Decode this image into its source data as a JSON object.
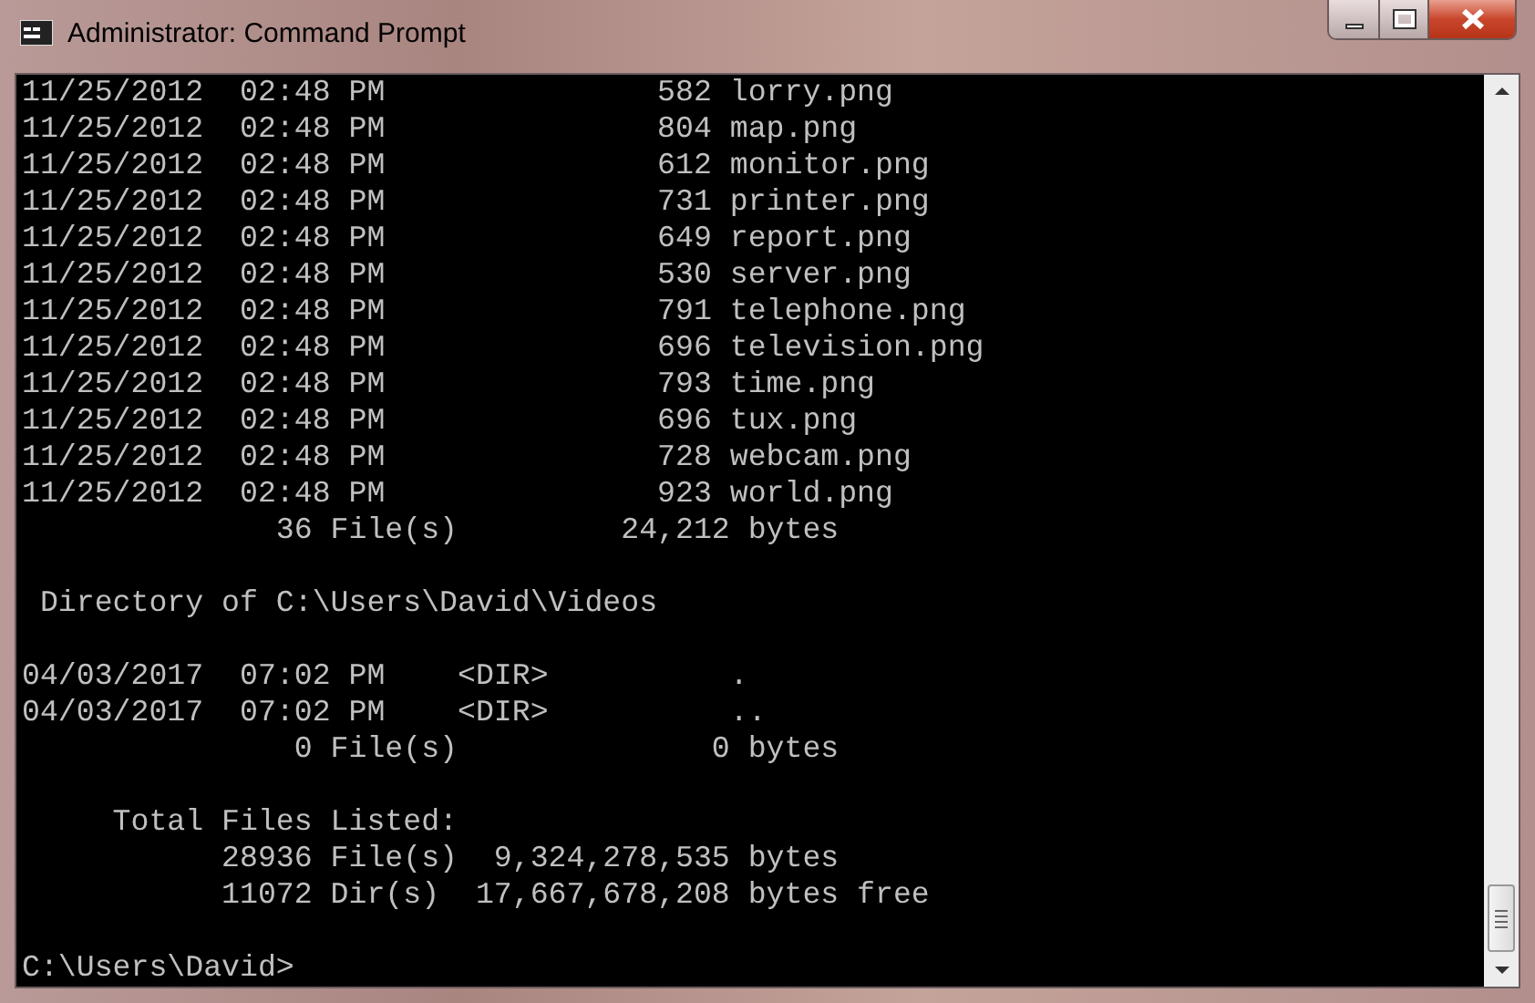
{
  "window": {
    "title": "Administrator: Command Prompt"
  },
  "console": {
    "blocks": [
      [
        "11/25/2012  02:48 PM               582 lorry.png",
        "11/25/2012  02:48 PM               804 map.png",
        "11/25/2012  02:48 PM               612 monitor.png",
        "11/25/2012  02:48 PM               731 printer.png",
        "11/25/2012  02:48 PM               649 report.png",
        "11/25/2012  02:48 PM               530 server.png",
        "11/25/2012  02:48 PM               791 telephone.png",
        "11/25/2012  02:48 PM               696 television.png",
        "11/25/2012  02:48 PM               793 time.png",
        "11/25/2012  02:48 PM               696 tux.png",
        "11/25/2012  02:48 PM               728 webcam.png",
        "11/25/2012  02:48 PM               923 world.png",
        "              36 File(s)         24,212 bytes"
      ],
      [
        " Directory of C:\\Users\\David\\Videos"
      ],
      [
        "04/03/2017  07:02 PM    <DIR>          .",
        "04/03/2017  07:02 PM    <DIR>          ..",
        "               0 File(s)              0 bytes"
      ],
      [
        "     Total Files Listed:",
        "           28936 File(s)  9,324,278,535 bytes",
        "           11072 Dir(s)  17,667,678,208 bytes free"
      ],
      [
        "C:\\Users\\David>"
      ]
    ]
  }
}
